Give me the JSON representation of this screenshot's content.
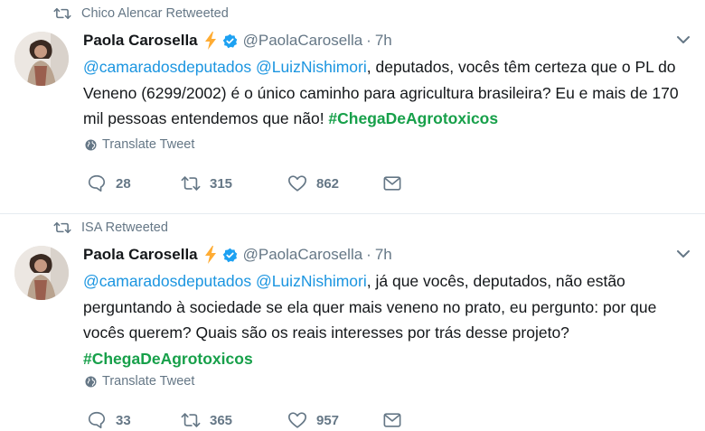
{
  "tweets": [
    {
      "retweeted_by": "Chico Alencar Retweeted",
      "name": "Paola Carosella",
      "handle": "@PaolaCarosella",
      "dot": "·",
      "time": "7h",
      "text": {
        "mention1": "@camaradosdeputados",
        "mention2": "@LuizNishimori",
        "rest": ", deputados, vocês têm certeza que o PL do Veneno (6299/2002) é o único caminho para agricultura brasileira? Eu e mais de 170 mil pessoas entendemos que não! ",
        "hashtag": "#ChegaDeAgrotoxicos"
      },
      "translate_label": "Translate Tweet",
      "replies": "28",
      "retweets": "315",
      "likes": "862"
    },
    {
      "retweeted_by": "ISA Retweeted",
      "name": "Paola Carosella",
      "handle": "@PaolaCarosella",
      "dot": "·",
      "time": "7h",
      "text": {
        "mention1": "@camaradosdeputados",
        "mention2": "@LuizNishimori",
        "rest": ", já que vocês, deputados, não estão perguntando à sociedade se ela quer mais veneno no prato, eu pergunto: por que vocês querem? Quais são os reais interesses por trás desse projeto? ",
        "hashtag": "#ChegaDeAgrotoxicos"
      },
      "translate_label": "Translate Tweet",
      "replies": "33",
      "retweets": "365",
      "likes": "957"
    }
  ],
  "colors": {
    "link": "#1b95e0",
    "hashtag": "#17a04a",
    "muted": "#657786",
    "verified": "#1da1f2",
    "bolt": "#ffac33"
  },
  "icons": [
    "retweet-icon",
    "lightning-bolt-icon",
    "verified-badge-icon",
    "chevron-down-icon",
    "globe-icon",
    "reply-icon",
    "heart-icon",
    "direct-message-icon"
  ]
}
